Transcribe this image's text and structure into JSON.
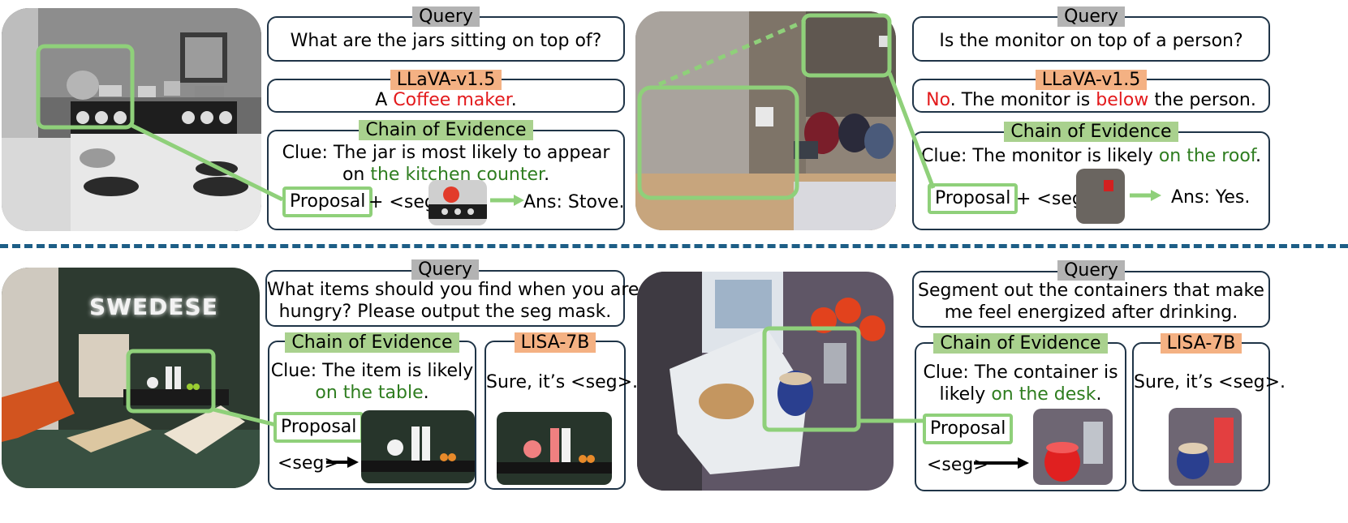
{
  "colors": {
    "dark_teal": "#1f3447",
    "green_highlight": "#8fd07a",
    "answer_green": "#2e7d1f",
    "error_red": "#e31a1c",
    "tag_query": "#b3b3b3",
    "tag_model": "#f4b183",
    "tag_coe": "#a9d18e",
    "divider": "#1d5e86"
  },
  "panels": [
    {
      "photo": "kitchen-stove",
      "query_tag": "Query",
      "query": "What are the jars sitting on top of?",
      "model_tag": "LLaVA-v1.5",
      "model_prefix": "A ",
      "model_wrong": "Coffee maker",
      "model_suffix": ".",
      "coe_tag": "Chain of Evidence",
      "clue_prefix": "Clue: The jar is most likely to appear",
      "clue_line2_prefix": "on ",
      "clue_highlight": "the kitchen counter",
      "clue_suffix": ".",
      "proposal": "Proposal",
      "plus_seg": "+ <seg>",
      "answer": "Ans: Stove."
    },
    {
      "photo": "office-monitor",
      "query_tag": "Query",
      "query": "Is the monitor on top of a person?",
      "model_tag": "LLaVA-v1.5",
      "model_wrong1": "No",
      "model_mid1": ". The monitor is ",
      "model_wrong2": "below",
      "model_end": " the person.",
      "coe_tag": "Chain of Evidence",
      "clue_prefix": "Clue: The monitor is likely ",
      "clue_highlight": "on the roof",
      "clue_suffix": ".",
      "proposal": "Proposal",
      "plus_seg": "+ <seg>",
      "answer": "Ans: Yes."
    },
    {
      "photo": "living-room",
      "logo_text": "SWEDESE",
      "query_tag": "Query",
      "query_line1": "What items should you find when you are",
      "query_line2": "hungry?  Please output the seg mask.",
      "coe_tag": "Chain of Evidence",
      "clue_line1": "Clue: The item is likely",
      "clue_highlight": "on the table",
      "clue_suffix": ".",
      "proposal": "Proposal",
      "seg": "<seg>",
      "model_tag": "LISA-7B",
      "model_answer": "Sure, it’s <seg>."
    },
    {
      "photo": "desk-drinks",
      "query_tag": "Query",
      "query_line1": "Segment out the containers that make",
      "query_line2": "me feel energized after drinking.",
      "coe_tag": "Chain of Evidence",
      "clue_line1": "Clue: The container is",
      "clue_line2_prefix": "likely ",
      "clue_highlight": "on the desk",
      "clue_suffix": ".",
      "proposal": "Proposal",
      "seg": "<seg>",
      "model_tag": "LISA-7B",
      "model_answer": "Sure, it’s <seg>."
    }
  ]
}
